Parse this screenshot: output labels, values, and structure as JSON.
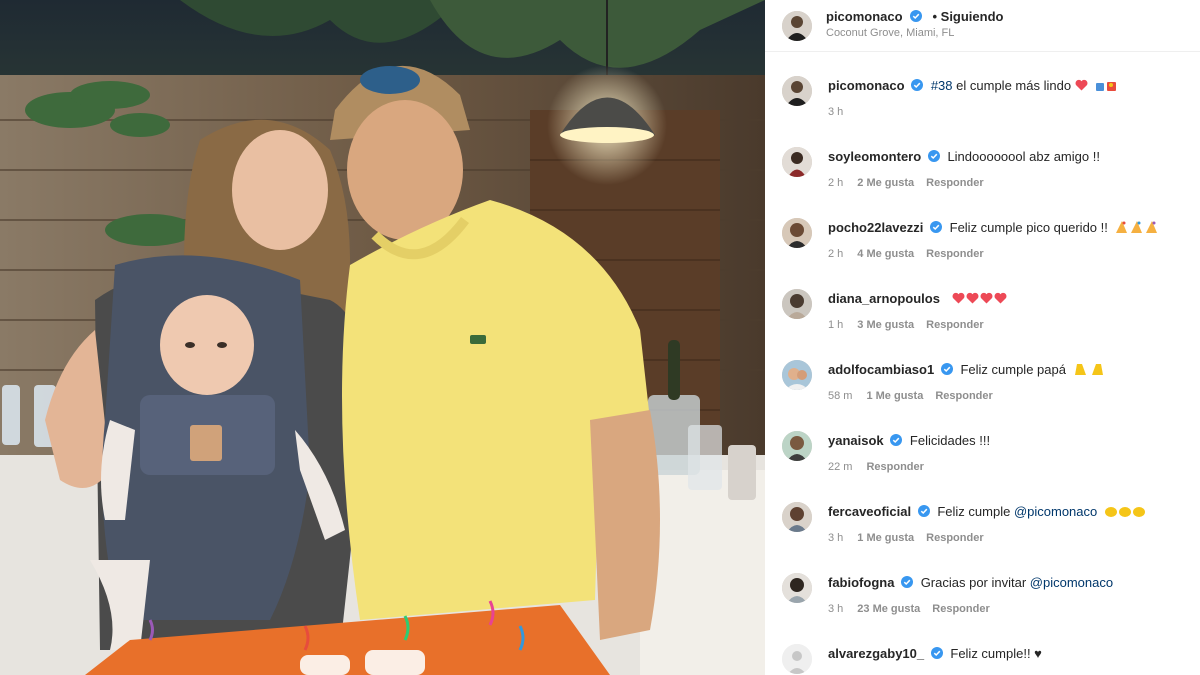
{
  "post": {
    "username": "picomonaco",
    "follow_status": "• Siguiendo",
    "location": "Coconut Grove, Miami, FL"
  },
  "caption": {
    "username": "picomonaco",
    "hashtag": "#38",
    "text": "el cumple más lindo",
    "time": "3 h"
  },
  "comments": [
    {
      "username": "soyleomontero",
      "verified": true,
      "text": "Lindoooooool abz amigo !!",
      "time": "2 h",
      "likes": "2 Me gusta",
      "reply": "Responder"
    },
    {
      "username": "pocho22lavezzi",
      "verified": true,
      "text": "Feliz cumple pico querido !!",
      "time": "2 h",
      "likes": "4 Me gusta",
      "reply": "Responder"
    },
    {
      "username": "diana_arnopoulos",
      "verified": false,
      "text": "",
      "time": "1 h",
      "likes": "3 Me gusta",
      "reply": "Responder"
    },
    {
      "username": "adolfocambiaso1",
      "verified": true,
      "text": "Feliz cumple papá",
      "time": "58 m",
      "likes": "1 Me gusta",
      "reply": "Responder"
    },
    {
      "username": "yanaisok",
      "verified": true,
      "text": "Felicidades !!!",
      "time": "22 m",
      "likes": "",
      "reply": "Responder"
    },
    {
      "username": "fercaveoficial",
      "verified": true,
      "text": "Feliz cumple",
      "mention": "@picomonaco",
      "time": "3 h",
      "likes": "1 Me gusta",
      "reply": "Responder"
    },
    {
      "username": "fabiofogna",
      "verified": true,
      "text": "Gracias por invitar",
      "mention": "@picomonaco",
      "time": "3 h",
      "likes": "23 Me gusta",
      "reply": "Responder"
    },
    {
      "username": "alvarezgaby10_",
      "verified": true,
      "text": "Feliz cumple!! ♥",
      "time": "",
      "likes": "",
      "reply": ""
    }
  ],
  "colors": {
    "verified": "#3897f0",
    "heart": "#ed4956",
    "mention": "#00376b",
    "muted": "#8e8e8e"
  }
}
